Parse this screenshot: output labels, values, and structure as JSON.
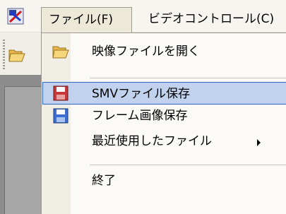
{
  "menubar": {
    "file_label": "ファイル(F)",
    "video_control_label": "ビデオコントロール(C)"
  },
  "file_menu": {
    "items": [
      {
        "label": "映像ファイルを開く",
        "icon": "open-folder-icon"
      },
      {
        "label": "SMVファイル保存",
        "icon": "save-smv-icon"
      },
      {
        "label": "フレーム画像保存",
        "icon": "save-frame-icon"
      },
      {
        "label": "最近使用したファイル",
        "icon": "",
        "submenu": true
      },
      {
        "label": "終了",
        "icon": ""
      }
    ]
  },
  "colors": {
    "highlight_bg": "#c1d2ee",
    "highlight_border": "#3169c6",
    "menu_bg": "#fbfaf6"
  }
}
